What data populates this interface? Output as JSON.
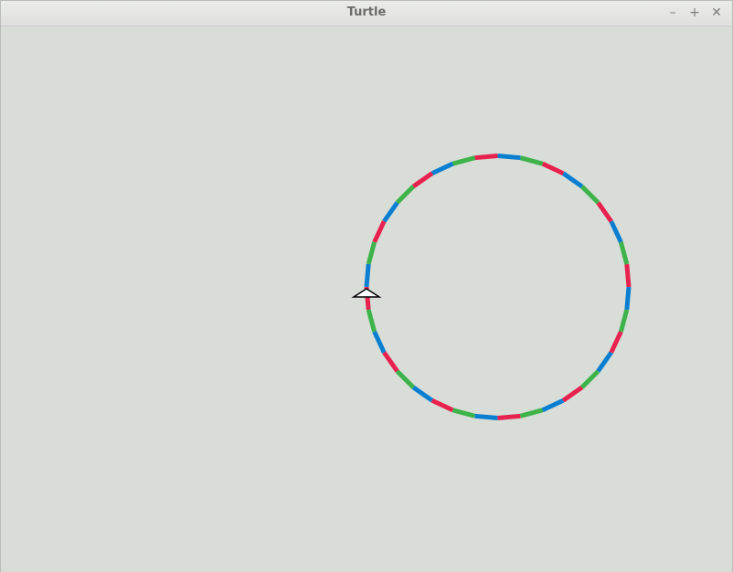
{
  "window": {
    "title": "Turtle",
    "controls": {
      "minimize": "–",
      "maximize": "+",
      "close": "✕"
    }
  },
  "canvas": {
    "background": "#d8ddd8",
    "pen_colors": [
      "#e8224f",
      "#3eb34a",
      "#0a7fd1"
    ],
    "turtle_shape": "arrow",
    "turtle_fill": "#ffffff",
    "turtle_outline": "#000000"
  }
}
